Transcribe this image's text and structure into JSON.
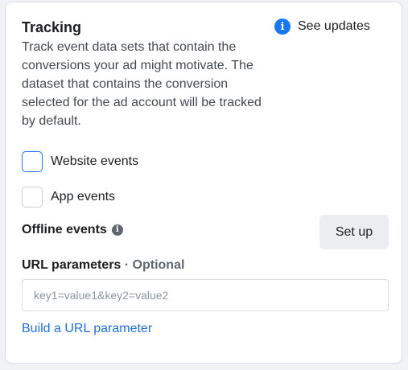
{
  "tracking": {
    "title": "Tracking",
    "description": "Track event data sets that contain the conversions your ad might motivate. The dataset that contains the conversion selected for the ad account will be tracked by default.",
    "see_updates_label": "See updates",
    "see_updates_icon": "info-icon"
  },
  "events": {
    "website_label": "Website events",
    "website_checked": false,
    "app_label": "App events",
    "app_checked": false
  },
  "offline": {
    "label": "Offline events",
    "icon": "info-icon",
    "setup_label": "Set up"
  },
  "url_params": {
    "label": "URL parameters",
    "separator": " · ",
    "optional_label": "Optional",
    "value": "",
    "placeholder": "key1=value1&key2=value2",
    "build_link_label": "Build a URL parameter"
  },
  "colors": {
    "accent": "#1877f2",
    "link": "#216fdb",
    "button_bg": "#ebedf0"
  }
}
